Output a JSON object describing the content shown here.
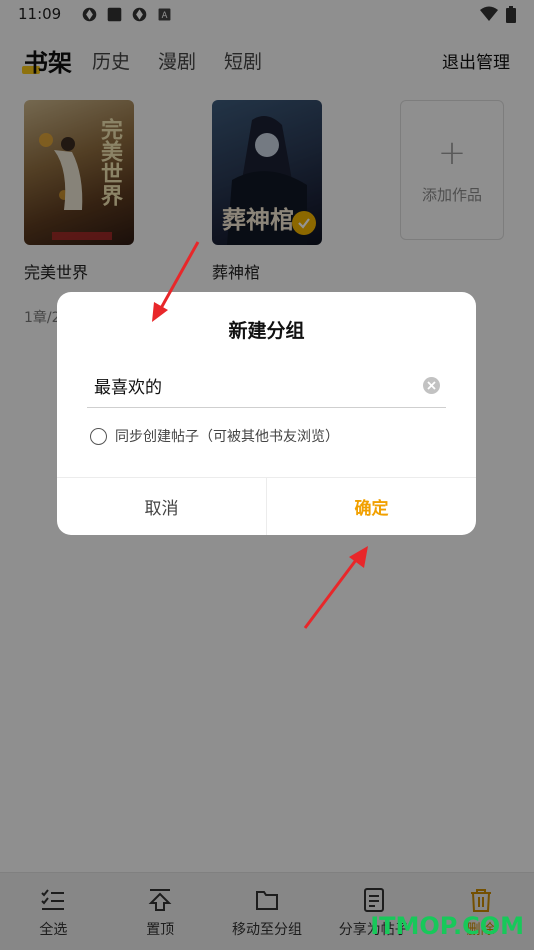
{
  "status": {
    "time": "11:09"
  },
  "header": {
    "tabs": [
      "书架",
      "历史",
      "漫剧",
      "短剧"
    ],
    "exit_label": "退出管理"
  },
  "books": [
    {
      "title": "完美世界",
      "cover_text": "完美世界"
    },
    {
      "title": "葬神棺",
      "cover_text": "葬神棺"
    }
  ],
  "add_label": "添加作品",
  "progress_text": "1章/2",
  "dialog": {
    "title": "新建分组",
    "input_value": "最喜欢的",
    "sync_label": "同步创建帖子（可被其他书友浏览）",
    "cancel_label": "取消",
    "ok_label": "确定"
  },
  "bottom_bar": {
    "items": [
      "全选",
      "置顶",
      "移动至分组",
      "分享为帖子",
      "删除"
    ]
  },
  "colors": {
    "accent": "#f1a000",
    "watermark": "#18c85a",
    "arrow": "#e8272a"
  },
  "watermark": "ITMOP.COM"
}
